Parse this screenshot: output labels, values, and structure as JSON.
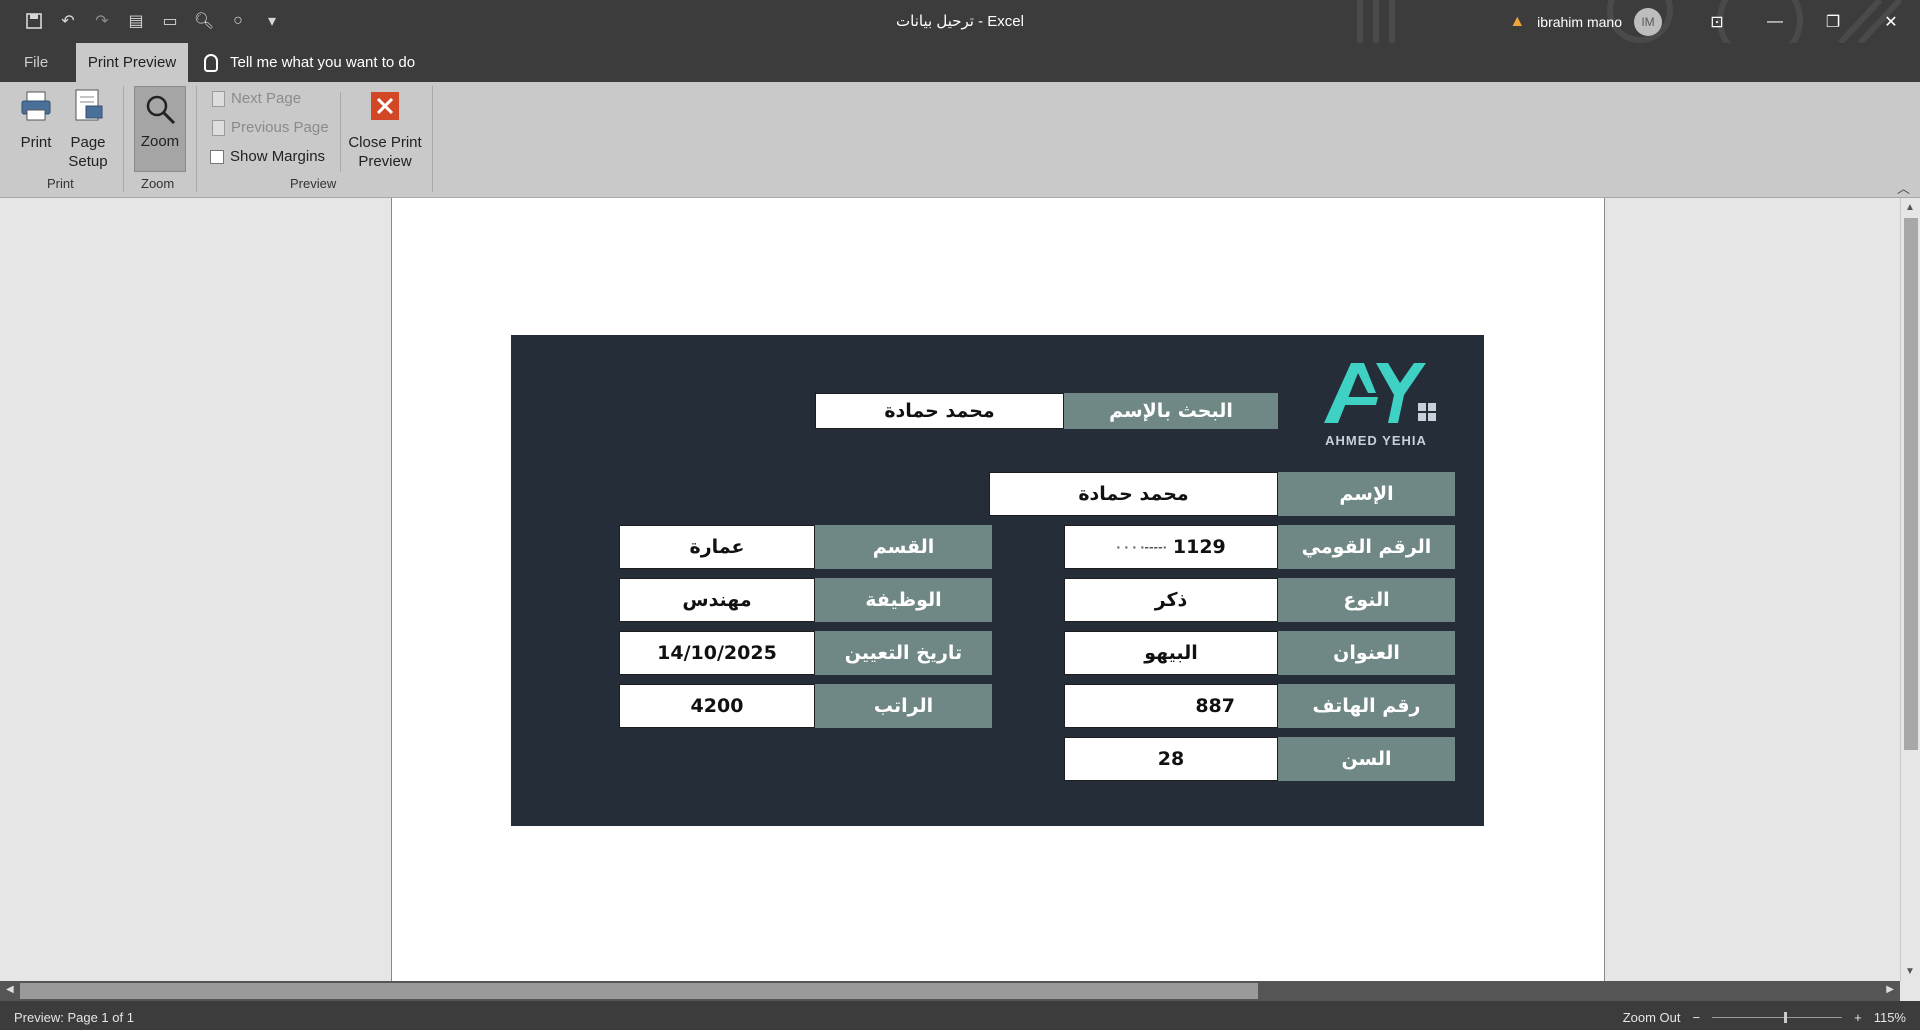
{
  "window": {
    "title": "ترحيل بيانات  -  Excel",
    "user": "ibrahim mano",
    "avatar_initials": "IM"
  },
  "tabs": {
    "file": "File",
    "print_preview": "Print Preview",
    "tell_me": "Tell me what you want to do"
  },
  "ribbon": {
    "print": "Print",
    "page_setup_1": "Page",
    "page_setup_2": "Setup",
    "zoom": "Zoom",
    "next_page": "Next Page",
    "previous_page": "Previous Page",
    "show_margins": "Show Margins",
    "close_1": "Close Print",
    "close_2": "Preview",
    "group_print": "Print",
    "group_zoom": "Zoom",
    "group_preview": "Preview"
  },
  "form": {
    "brand": "AHMED YEHIA",
    "search_label": "البحث بالإسم",
    "search_value": "محمد حمادة",
    "name_label": "الإسم",
    "name_value": "محمد حمادة",
    "national_id_label": "الرقم القومي",
    "national_id_value": "1129",
    "gender_label": "النوع",
    "gender_value": "ذكر",
    "address_label": "العنوان",
    "address_value": "البيهو",
    "phone_label": "رقم الهاتف",
    "phone_value": "887",
    "age_label": "السن",
    "age_value": "28",
    "department_label": "القسم",
    "department_value": "عمارة",
    "job_label": "الوظيفة",
    "job_value": "مهندس",
    "hire_date_label": "تاريخ التعيين",
    "hire_date_value": "14/10/2025",
    "salary_label": "الراتب",
    "salary_value": "4200"
  },
  "status": {
    "preview": "Preview: Page 1 of 1",
    "zoom_out": "Zoom Out",
    "zoom_level": "115%"
  },
  "colors": {
    "card_bg": "#242d38",
    "label_bg": "#6f8785",
    "logo_accent": "#3fd1c4",
    "close_icon": "#d24726"
  }
}
